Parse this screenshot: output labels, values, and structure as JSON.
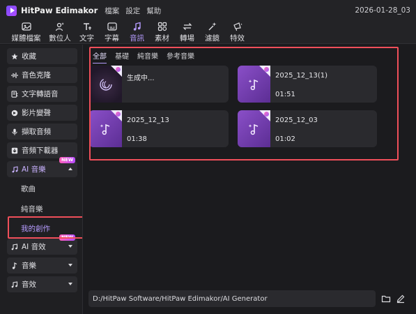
{
  "app": {
    "title": "HitPaw Edimakor",
    "menu": [
      "檔案",
      "設定",
      "幫助"
    ],
    "project_date": "2026-01-28_03"
  },
  "toolbar": {
    "items": [
      {
        "label": "媒體檔案",
        "icon": "media-icon",
        "active": false
      },
      {
        "label": "數位人",
        "icon": "digital-human-icon",
        "active": false
      },
      {
        "label": "文字",
        "icon": "text-icon",
        "active": false
      },
      {
        "label": "字幕",
        "icon": "subtitle-icon",
        "active": false
      },
      {
        "label": "音訊",
        "icon": "music-note-icon",
        "active": true
      },
      {
        "label": "素材",
        "icon": "assets-icon",
        "active": false
      },
      {
        "label": "轉場",
        "icon": "transition-icon",
        "active": false
      },
      {
        "label": "濾鏡",
        "icon": "filter-icon",
        "active": false
      },
      {
        "label": "特效",
        "icon": "effects-icon",
        "active": false
      }
    ],
    "accent_color": "#b69cff"
  },
  "sidebar": {
    "items": [
      {
        "label": "收藏",
        "icon": "star-icon"
      },
      {
        "label": "音色克隆",
        "icon": "waveform-icon"
      },
      {
        "label": "文字轉語音",
        "icon": "text-to-speech-icon"
      },
      {
        "label": "影片變聲",
        "icon": "voice-changer-icon"
      },
      {
        "label": "擷取音頻",
        "icon": "microphone-icon"
      },
      {
        "label": "音頻下載器",
        "icon": "download-icon"
      },
      {
        "label": "AI 音樂",
        "icon": "ai-music-icon",
        "badge": "NEW",
        "expanded": true
      },
      {
        "label": "AI 音效",
        "icon": "ai-sfx-icon",
        "badge": "NEW",
        "expanded": false
      },
      {
        "label": "音樂",
        "icon": "music-icon",
        "expanded": false
      },
      {
        "label": "音效",
        "icon": "sound-effect-icon",
        "expanded": false
      }
    ],
    "ai_music_sub": [
      "歌曲",
      "純音樂",
      "我的創作"
    ],
    "active_sub": "我的創作"
  },
  "main": {
    "tabs": [
      "全部",
      "基礎",
      "純音樂",
      "參考音樂"
    ],
    "active_tab": "全部",
    "cards": [
      {
        "title": "生成中...",
        "duration": "",
        "state": "generating"
      },
      {
        "title": "2025_12_13(1)",
        "duration": "01:51",
        "state": "done"
      },
      {
        "title": "2025_12_13",
        "duration": "01:38",
        "state": "done"
      },
      {
        "title": "2025_12_03",
        "duration": "01:02",
        "state": "done"
      }
    ],
    "path": "D:/HitPaw Software/HitPaw Edimakor/AI Generator"
  },
  "highlight_color": "#f04f5a"
}
